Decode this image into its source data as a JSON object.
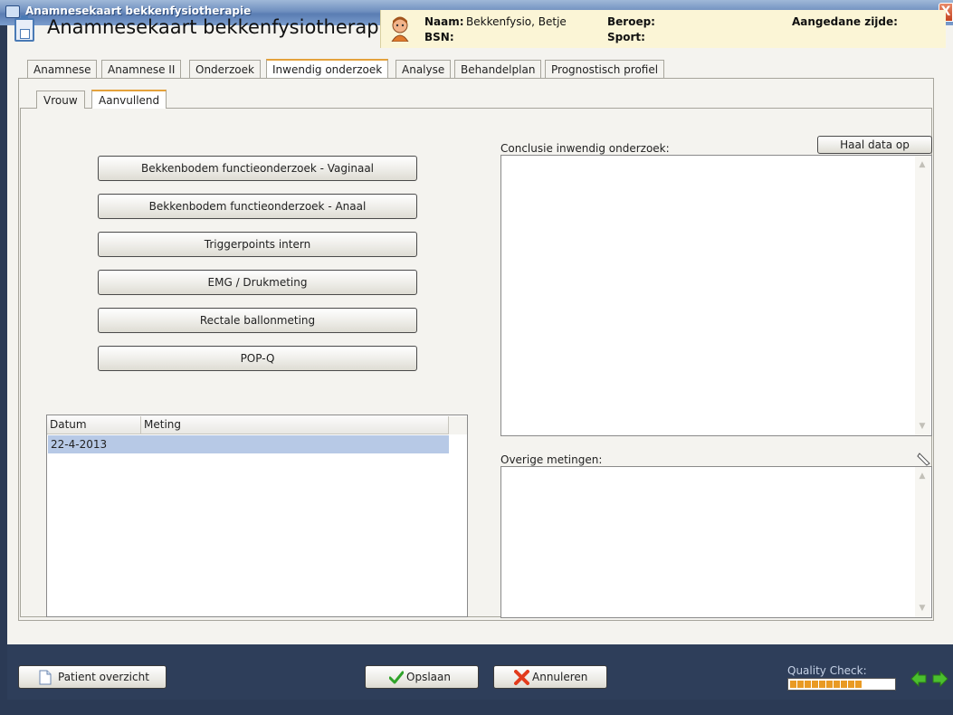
{
  "window": {
    "title": "Anamnesekaart bekkenfysiotherapie",
    "close_glyph": "X"
  },
  "header": {
    "title": "Anamnesekaart bekkenfysiotherapie"
  },
  "patient": {
    "naam_label": "Naam:",
    "naam_value": "Bekkenfysio, Betje",
    "bsn_label": "BSN:",
    "bsn_value": "",
    "beroep_label": "Beroep:",
    "beroep_value": "",
    "sport_label": "Sport:",
    "sport_value": "",
    "zijde_label": "Aangedane zijde:",
    "zijde_value": ""
  },
  "tabs": [
    {
      "label": "Anamnese"
    },
    {
      "label": "Anamnese II"
    },
    {
      "label": "Onderzoek"
    },
    {
      "label": "Inwendig onderzoek",
      "active": true
    },
    {
      "label": "Analyse"
    },
    {
      "label": "Behandelplan"
    },
    {
      "label": "Prognostisch profiel"
    }
  ],
  "subtabs": [
    {
      "label": "Vrouw"
    },
    {
      "label": "Aanvullend",
      "active": true
    }
  ],
  "actions": [
    {
      "label": "Bekkenbodem functieonderzoek - Vaginaal"
    },
    {
      "label": "Bekkenbodem functieonderzoek - Anaal"
    },
    {
      "label": "Triggerpoints intern"
    },
    {
      "label": "EMG / Drukmeting"
    },
    {
      "label": "Rectale ballonmeting"
    },
    {
      "label": "POP-Q"
    }
  ],
  "table": {
    "columns": [
      "Datum",
      "Meting"
    ],
    "rows": [
      [
        "22-4-2013",
        ""
      ]
    ]
  },
  "conclusie": {
    "label": "Conclusie inwendig onderzoek:",
    "value": "",
    "button": "Haal data op"
  },
  "overige": {
    "label": "Overige metingen:",
    "value": ""
  },
  "bottom": {
    "patient_overzicht": "Patient overzicht",
    "opslaan": "Opslaan",
    "annuleren": "Annuleren",
    "quality_label": "Quality Check:"
  },
  "colors": {
    "accent": "#e4a23b",
    "selection": "#b7c9e6",
    "bottombar": "#2e3e5a",
    "quality": "#e99a24"
  },
  "icons": {
    "app": "form-icon",
    "avatar": "patient-avatar-icon",
    "save": "checkmark-icon",
    "cancel": "x-icon",
    "doc": "document-icon",
    "prev": "arrow-left-icon",
    "next": "arrow-right-icon"
  }
}
